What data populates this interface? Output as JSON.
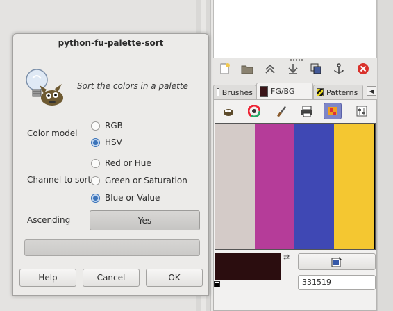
{
  "dialog": {
    "title": "python-fu-palette-sort",
    "description": "Sort the colors in a palette",
    "color_model": {
      "label": "Color model",
      "options": [
        {
          "label": "RGB",
          "selected": false
        },
        {
          "label": "HSV",
          "selected": true
        }
      ]
    },
    "channel": {
      "label": "Channel to sort",
      "options": [
        {
          "label": "Red or Hue",
          "selected": false
        },
        {
          "label": "Green or Saturation",
          "selected": false
        },
        {
          "label": "Blue or Value",
          "selected": true
        }
      ]
    },
    "ascending": {
      "label": "Ascending",
      "value": "Yes"
    },
    "progress": 0,
    "buttons": {
      "help": "Help",
      "cancel": "Cancel",
      "ok": "OK"
    }
  },
  "dock": {
    "tabs": [
      {
        "label": "Brushes",
        "active": false
      },
      {
        "label": "FG/BG",
        "active": true
      },
      {
        "label": "Patterns",
        "active": false
      }
    ],
    "palette_swatches": [
      "#d4cbc8",
      "#b53c99",
      "#3f48b4",
      "#f4c731"
    ],
    "fg_color": "#2b0d0f",
    "bg_color": "#ffffff",
    "hex_value": "331519"
  }
}
